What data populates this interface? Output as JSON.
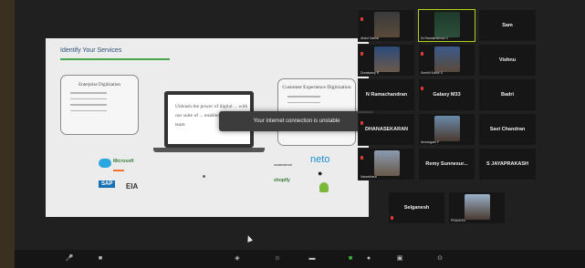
{
  "slide": {
    "title": "Identify Your Services",
    "left_box_title": "Enterprise Digitization",
    "right_box_title": "Customer Experience Digitization",
    "laptop_text": "Unleash the power of digital ... with our suite of ... enabled by an agile team",
    "logos": {
      "microsoft": "Microsoft",
      "sap": "SAP",
      "eia": "EIA",
      "commerce": "commerce",
      "neto": "neto",
      "shopify": "shopify"
    }
  },
  "toast": {
    "message": "Your internet connection is unstable"
  },
  "gallery": {
    "tiles": [
      {
        "name": "",
        "label": "Abdul Kathar"
      },
      {
        "name": "",
        "label": "Dr.Ramakrishnan V"
      },
      {
        "name": "Sam",
        "label": ""
      },
      {
        "name": "",
        "label": "Duraisamy R"
      },
      {
        "name": "",
        "label": "Senthil Kathir S"
      },
      {
        "name": "Vishnu",
        "label": ""
      },
      {
        "name": "N Ramachandran",
        "label": ""
      },
      {
        "name": "Galaxy M33",
        "label": ""
      },
      {
        "name": "Badri",
        "label": ""
      },
      {
        "name": "DHANASEKARAN",
        "label": ""
      },
      {
        "name": "",
        "label": "Arumugam P"
      },
      {
        "name": "Savi Chandran",
        "label": ""
      },
      {
        "name": "",
        "label": "Vasanthara"
      },
      {
        "name": "Remy Sunnesur...",
        "label": ""
      },
      {
        "name": "S JAYAPRAKASH",
        "label": ""
      },
      {
        "name": "Selganesh",
        "label": ""
      },
      {
        "name": "",
        "label": "PRAVEEN"
      }
    ]
  },
  "controls": {
    "mute": "mic-icon",
    "video": "video-icon",
    "security": "shield-icon",
    "participants": "participants-icon",
    "chat": "chat-icon",
    "share": "share-screen-icon",
    "record": "record-icon",
    "reactions": "reactions-icon"
  },
  "colors": {
    "active_speaker": "#b5d21a",
    "share_green": "#3fbf3f",
    "muted_red": "#e53935"
  }
}
